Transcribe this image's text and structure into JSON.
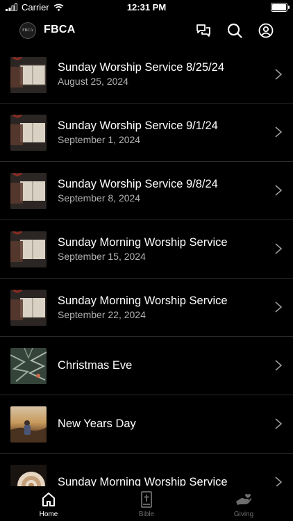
{
  "status_bar": {
    "carrier": "Carrier",
    "time": "12:31 PM"
  },
  "header": {
    "logo_text": "FBCA",
    "title": "FBCA"
  },
  "sermons": [
    {
      "title": "Sunday Worship Service 8/25/24",
      "date": "August 25, 2024"
    },
    {
      "title": "Sunday Worship Service 9/1/24",
      "date": "September 1, 2024"
    },
    {
      "title": "Sunday Worship Service 9/8/24",
      "date": "September 8, 2024"
    },
    {
      "title": "Sunday Morning Worship Service",
      "date": "September 15, 2024"
    },
    {
      "title": "Sunday Morning Worship Service",
      "date": "September 22, 2024"
    },
    {
      "title": "Christmas Eve",
      "date": ""
    },
    {
      "title": "New Years Day",
      "date": ""
    },
    {
      "title": "Sunday Morning Worship Service",
      "date": ""
    }
  ],
  "tabs": [
    {
      "label": "Home",
      "icon": "home-icon",
      "active": true
    },
    {
      "label": "Bible",
      "icon": "bible-icon",
      "active": false
    },
    {
      "label": "Giving",
      "icon": "giving-hand-icon",
      "active": false
    }
  ],
  "colors": {
    "background": "#000000",
    "text": "#ffffff",
    "secondary_text": "#b3b3b3",
    "inactive_tab": "#6e6e6e"
  }
}
